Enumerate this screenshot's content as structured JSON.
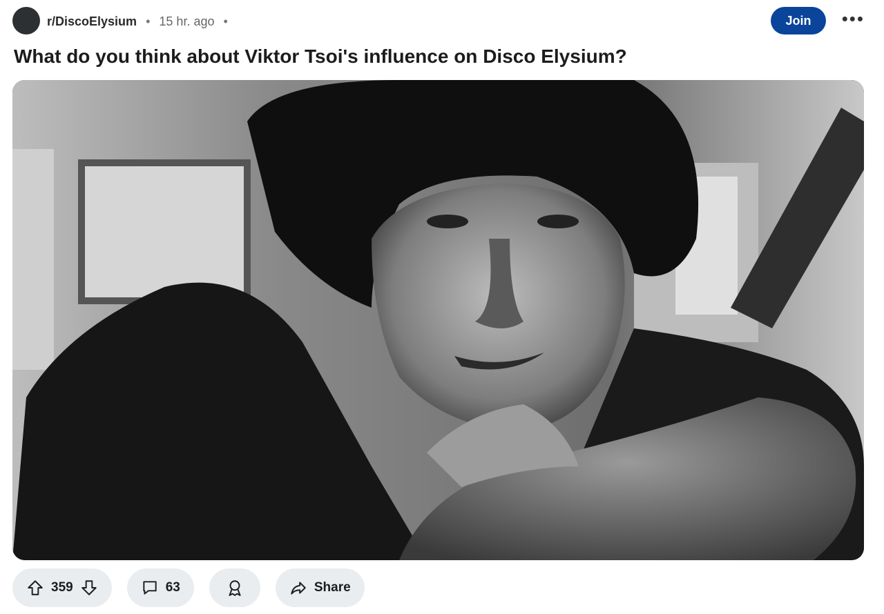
{
  "post": {
    "subreddit": "r/DiscoElysium",
    "separator": "•",
    "time": "15 hr. ago",
    "title": "What do you think about Viktor Tsoi's influence on Disco Elysium?"
  },
  "header": {
    "join_label": "Join",
    "more_icon": "more-horizontal-icon",
    "more_glyph": "•••"
  },
  "actions": {
    "upvotes": "359",
    "comments": "63",
    "share_label": "Share",
    "icons": [
      "upvote-icon",
      "downvote-icon",
      "comment-icon",
      "award-icon",
      "share-icon"
    ]
  },
  "colors": {
    "join_bg": "#0a449b",
    "pill_bg": "#e9edf0",
    "avatar": "#2d3033"
  }
}
